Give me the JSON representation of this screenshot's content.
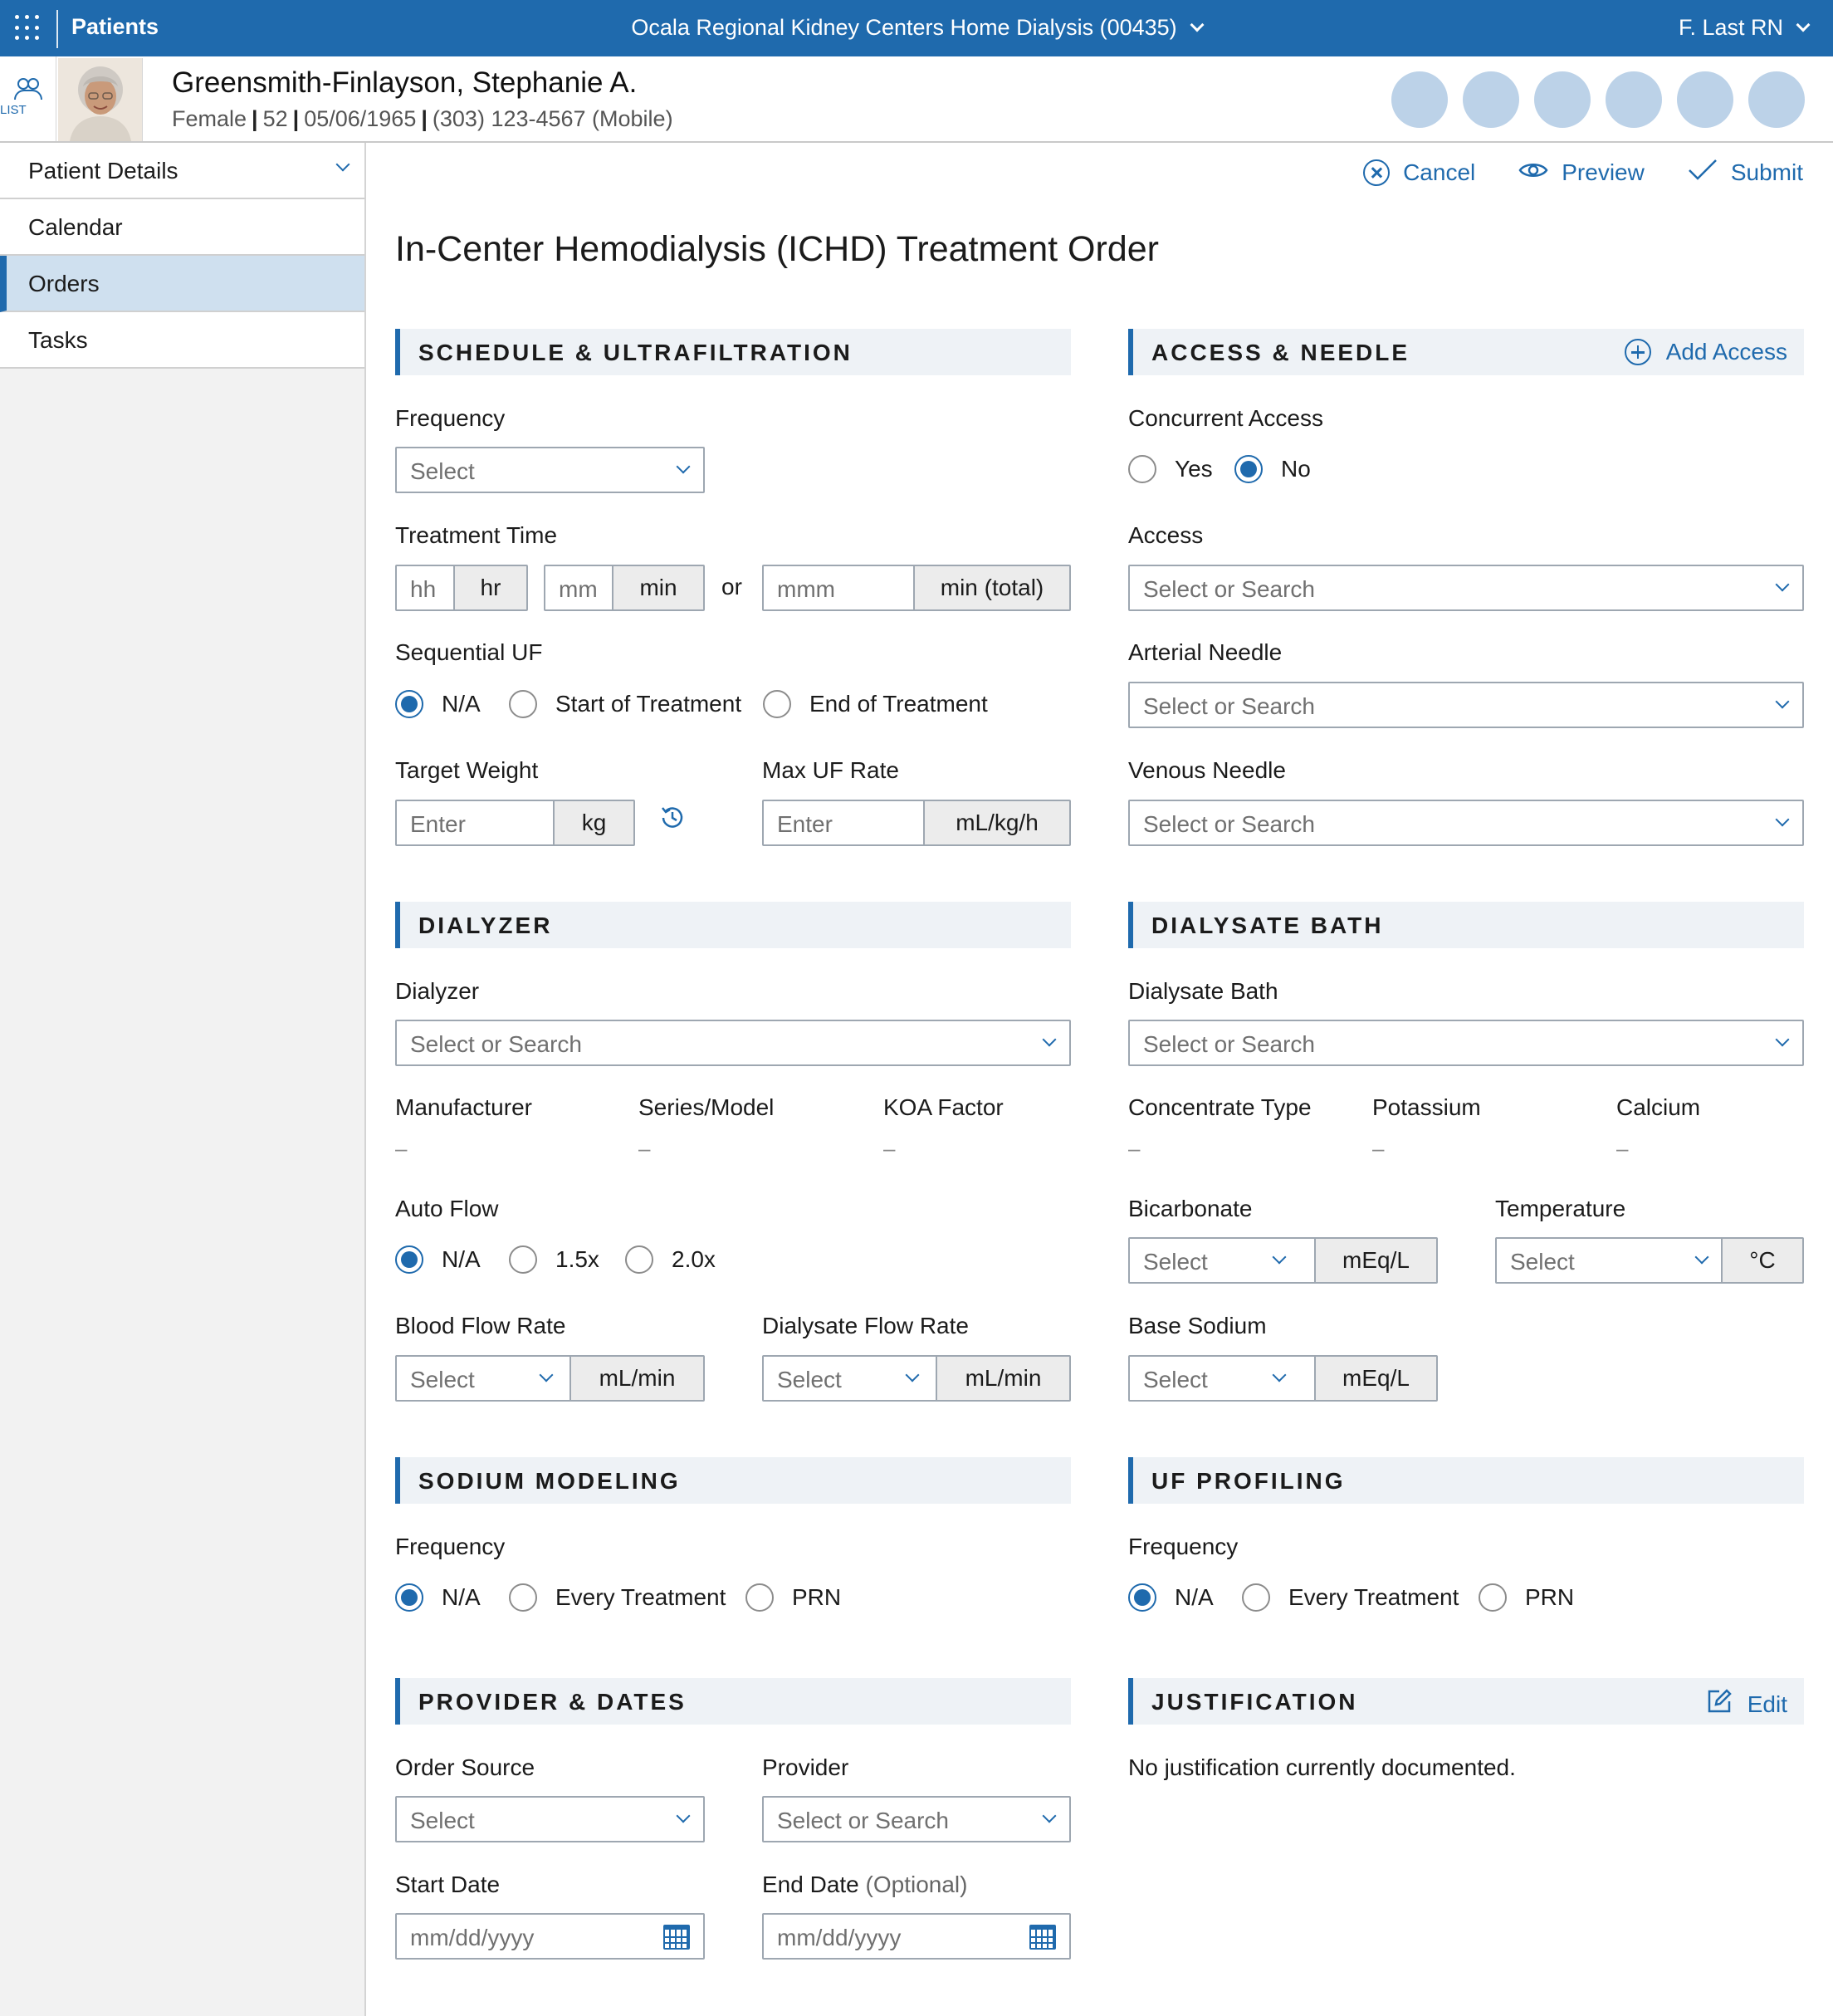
{
  "topbar": {
    "app_name": "Patients",
    "facility": "Ocala Regional Kidney Centers Home Dialysis (00435)",
    "user": "F. Last RN"
  },
  "patient": {
    "list_label": "LIST",
    "name": "Greensmith-Finlayson, Stephanie A.",
    "sex": "Female",
    "age": "52",
    "dob": "05/06/1965",
    "phone": "(303) 123-4567 (Mobile)"
  },
  "nav": {
    "header": "Patient Details",
    "items": [
      {
        "label": "Calendar"
      },
      {
        "label": "Orders"
      },
      {
        "label": "Tasks"
      }
    ]
  },
  "actions": {
    "cancel": "Cancel",
    "preview": "Preview",
    "submit": "Submit"
  },
  "page_title": "In-Center Hemodialysis (ICHD) Treatment Order",
  "schedule": {
    "title": "SCHEDULE & ULTRAFILTRATION",
    "frequency_label": "Frequency",
    "frequency_placeholder": "Select",
    "treatment_time_label": "Treatment Time",
    "hh_placeholder": "hh",
    "hr_unit": "hr",
    "mm_placeholder": "mm",
    "min_unit": "min",
    "or_text": "or",
    "mmm_placeholder": "mmm",
    "min_total_unit": "min (total)",
    "sequential_uf_label": "Sequential UF",
    "sequential_options": [
      "N/A",
      "Start of Treatment",
      "End of Treatment"
    ],
    "target_weight_label": "Target Weight",
    "target_weight_placeholder": "Enter",
    "kg_unit": "kg",
    "max_uf_label": "Max UF Rate",
    "max_uf_placeholder": "Enter",
    "max_uf_unit": "mL/kg/h"
  },
  "access": {
    "title": "ACCESS & NEEDLE",
    "add_access": "Add Access",
    "concurrent_label": "Concurrent Access",
    "concurrent_options": [
      "Yes",
      "No"
    ],
    "access_label": "Access",
    "access_placeholder": "Select or Search",
    "arterial_label": "Arterial Needle",
    "arterial_placeholder": "Select or Search",
    "venous_label": "Venous Needle",
    "venous_placeholder": "Select or Search"
  },
  "dialyzer": {
    "title": "DIALYZER",
    "dialyzer_label": "Dialyzer",
    "dialyzer_placeholder": "Select or Search",
    "manufacturer_label": "Manufacturer",
    "series_label": "Series/Model",
    "koa_label": "KOA Factor",
    "empty_value": "–",
    "auto_flow_label": "Auto Flow",
    "auto_flow_options": [
      "N/A",
      "1.5x",
      "2.0x"
    ],
    "blood_flow_label": "Blood Flow Rate",
    "blood_flow_placeholder": "Select",
    "blood_flow_unit": "mL/min",
    "dialysate_flow_label": "Dialysate Flow Rate",
    "dialysate_flow_placeholder": "Select",
    "dialysate_flow_unit": "mL/min"
  },
  "bath": {
    "title": "DIALYSATE BATH",
    "bath_label": "Dialysate Bath",
    "bath_placeholder": "Select or Search",
    "concentrate_label": "Concentrate Type",
    "potassium_label": "Potassium",
    "calcium_label": "Calcium",
    "empty_value": "–",
    "bicarbonate_label": "Bicarbonate",
    "bicarbonate_placeholder": "Select",
    "bicarbonate_unit": "mEq/L",
    "temperature_label": "Temperature",
    "temperature_placeholder": "Select",
    "temperature_unit": "°C",
    "base_sodium_label": "Base Sodium",
    "base_sodium_placeholder": "Select",
    "base_sodium_unit": "mEq/L"
  },
  "sodium": {
    "title": "SODIUM MODELING",
    "frequency_label": "Frequency",
    "options": [
      "N/A",
      "Every Treatment",
      "PRN"
    ]
  },
  "uf_profiling": {
    "title": "UF PROFILING",
    "frequency_label": "Frequency",
    "options": [
      "N/A",
      "Every Treatment",
      "PRN"
    ]
  },
  "provider": {
    "title": "PROVIDER & DATES",
    "order_source_label": "Order Source",
    "order_source_placeholder": "Select",
    "provider_label": "Provider",
    "provider_placeholder": "Select or Search",
    "start_date_label": "Start Date",
    "start_date_placeholder": "mm/dd/yyyy",
    "end_date_label": "End Date",
    "end_date_optional": "(Optional)",
    "end_date_placeholder": "mm/dd/yyyy"
  },
  "justification": {
    "title": "JUSTIFICATION",
    "edit": "Edit",
    "text": "No justification currently documented."
  },
  "colors": {
    "primary": "#1f6aad",
    "nav_active": "#cfe0ef",
    "section_bg": "#eef2f6"
  }
}
